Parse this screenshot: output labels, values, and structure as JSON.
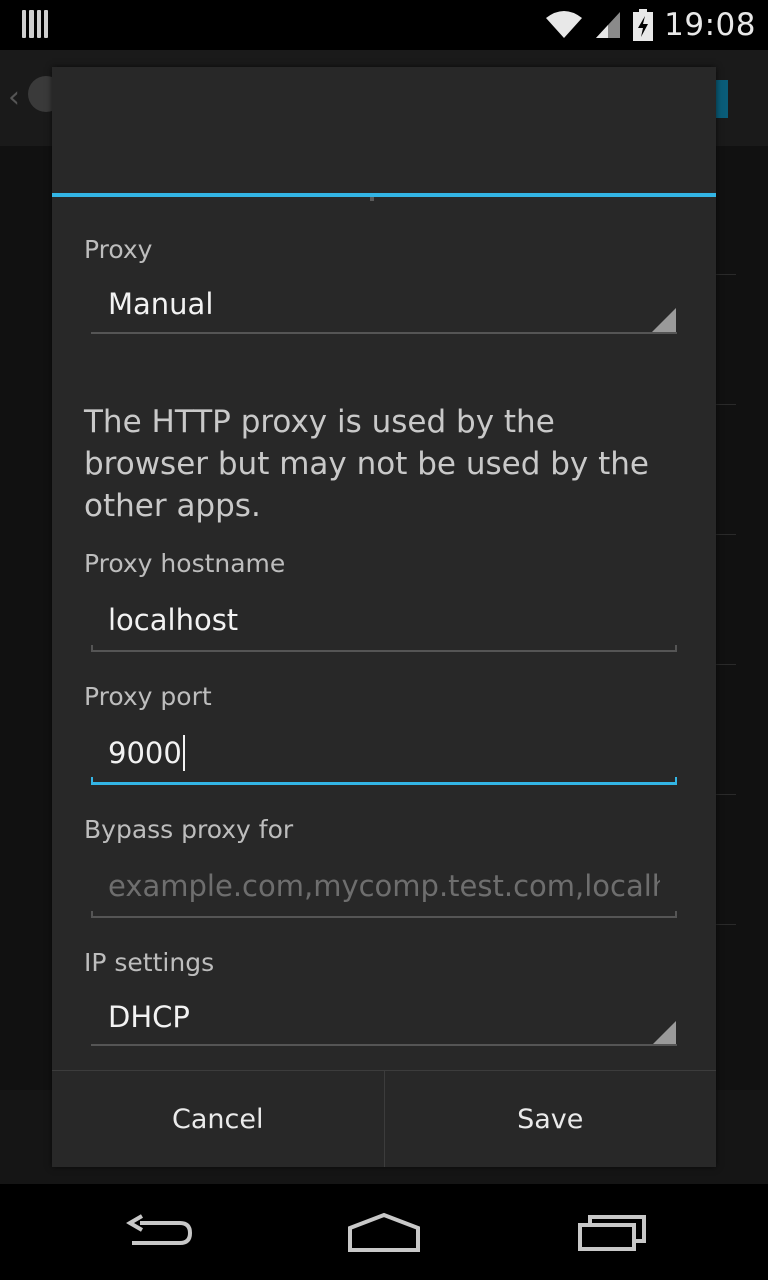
{
  "status_bar": {
    "time": "19:08",
    "icons": [
      "notification-bars-icon",
      "wifi-icon",
      "cell-signal-icon",
      "battery-charging-icon"
    ]
  },
  "dialog": {
    "proxy": {
      "label": "Proxy",
      "value": "Manual"
    },
    "help_text": "The HTTP proxy is used by the browser but may not be used by the other apps.",
    "proxy_hostname": {
      "label": "Proxy hostname",
      "value": "localhost"
    },
    "proxy_port": {
      "label": "Proxy port",
      "value": "9000"
    },
    "bypass": {
      "label": "Bypass proxy for",
      "placeholder": "example.com,mycomp.test.com,localhost"
    },
    "ip_settings": {
      "label": "IP settings",
      "value": "DHCP"
    },
    "buttons": {
      "cancel": "Cancel",
      "save": "Save"
    }
  },
  "colors": {
    "accent": "#33b5e5",
    "dialog_bg": "#282828"
  },
  "nav_bar": {
    "icons": [
      "back-icon",
      "home-icon",
      "recent-apps-icon"
    ]
  }
}
